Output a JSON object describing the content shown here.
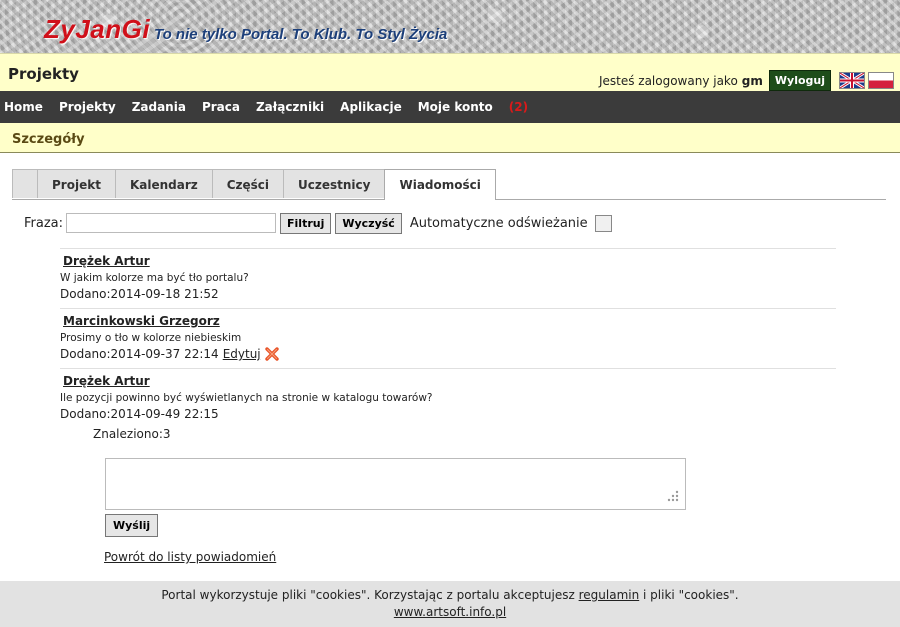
{
  "header": {
    "logo": "ZyJanGi",
    "tagline": "To nie tylko Portal. To Klub. To Styl Życia"
  },
  "titlebar": {
    "title": "Projekty",
    "logged_in_label": "Jesteś zalogowany jako",
    "username": "gm",
    "logout_label": "Wyloguj"
  },
  "nav": {
    "items": [
      "Home",
      "Projekty",
      "Zadania",
      "Praca",
      "Załączniki",
      "Aplikacje",
      "Moje konto"
    ],
    "badge": "(2)"
  },
  "section": {
    "title": "Szczegóły"
  },
  "tabs": [
    "Projekt",
    "Kalendarz",
    "Części",
    "Uczestnicy",
    "Wiadomości"
  ],
  "active_tab": "Wiadomości",
  "filter": {
    "label": "Fraza:",
    "value": "",
    "filter_button": "Filtruj",
    "clear_button": "Wyczyść",
    "auto_refresh_label": "Automatyczne odświeżanie",
    "auto_refresh_checked": false
  },
  "messages": [
    {
      "author": "Drężek Artur",
      "text": "W jakim kolorze ma być tło portalu?",
      "added": "Dodano:2014-09-18 21:52"
    },
    {
      "author": "Marcinkowski Grzegorz",
      "text": "Prosimy o tło w kolorze niebieskim",
      "added": "Dodano:2014-09-37 22:14",
      "edit_label": "Edytuj"
    },
    {
      "author": "Drężek Artur",
      "text": "Ile pozycji powinno być wyświetlanych na stronie w katalogu towarów?",
      "added": "Dodano:2014-09-49 22:15"
    }
  ],
  "found": "Znaleziono:3",
  "reply": {
    "value": "",
    "send_button": "Wyślij"
  },
  "back_link": "Powrót do listy powiadomień",
  "footer": {
    "text_before": "Portal wykorzystuje pliki \"cookies\". Korzystając z portalu akceptujesz",
    "link": "regulamin",
    "text_after": "i pliki \"cookies\".",
    "site": "www.artsoft.info.pl"
  },
  "colors": {
    "logo": "#d0101a",
    "tagline": "#1c3f7a",
    "nav_bg": "#3b3b3b",
    "yellow_bar": "#ffffc9",
    "logout_bg": "#1e4d1a",
    "badge": "#d91a1a"
  },
  "icons": [
    "flag-uk-icon",
    "flag-pl-icon",
    "delete-icon",
    "resize-grip-icon"
  ]
}
